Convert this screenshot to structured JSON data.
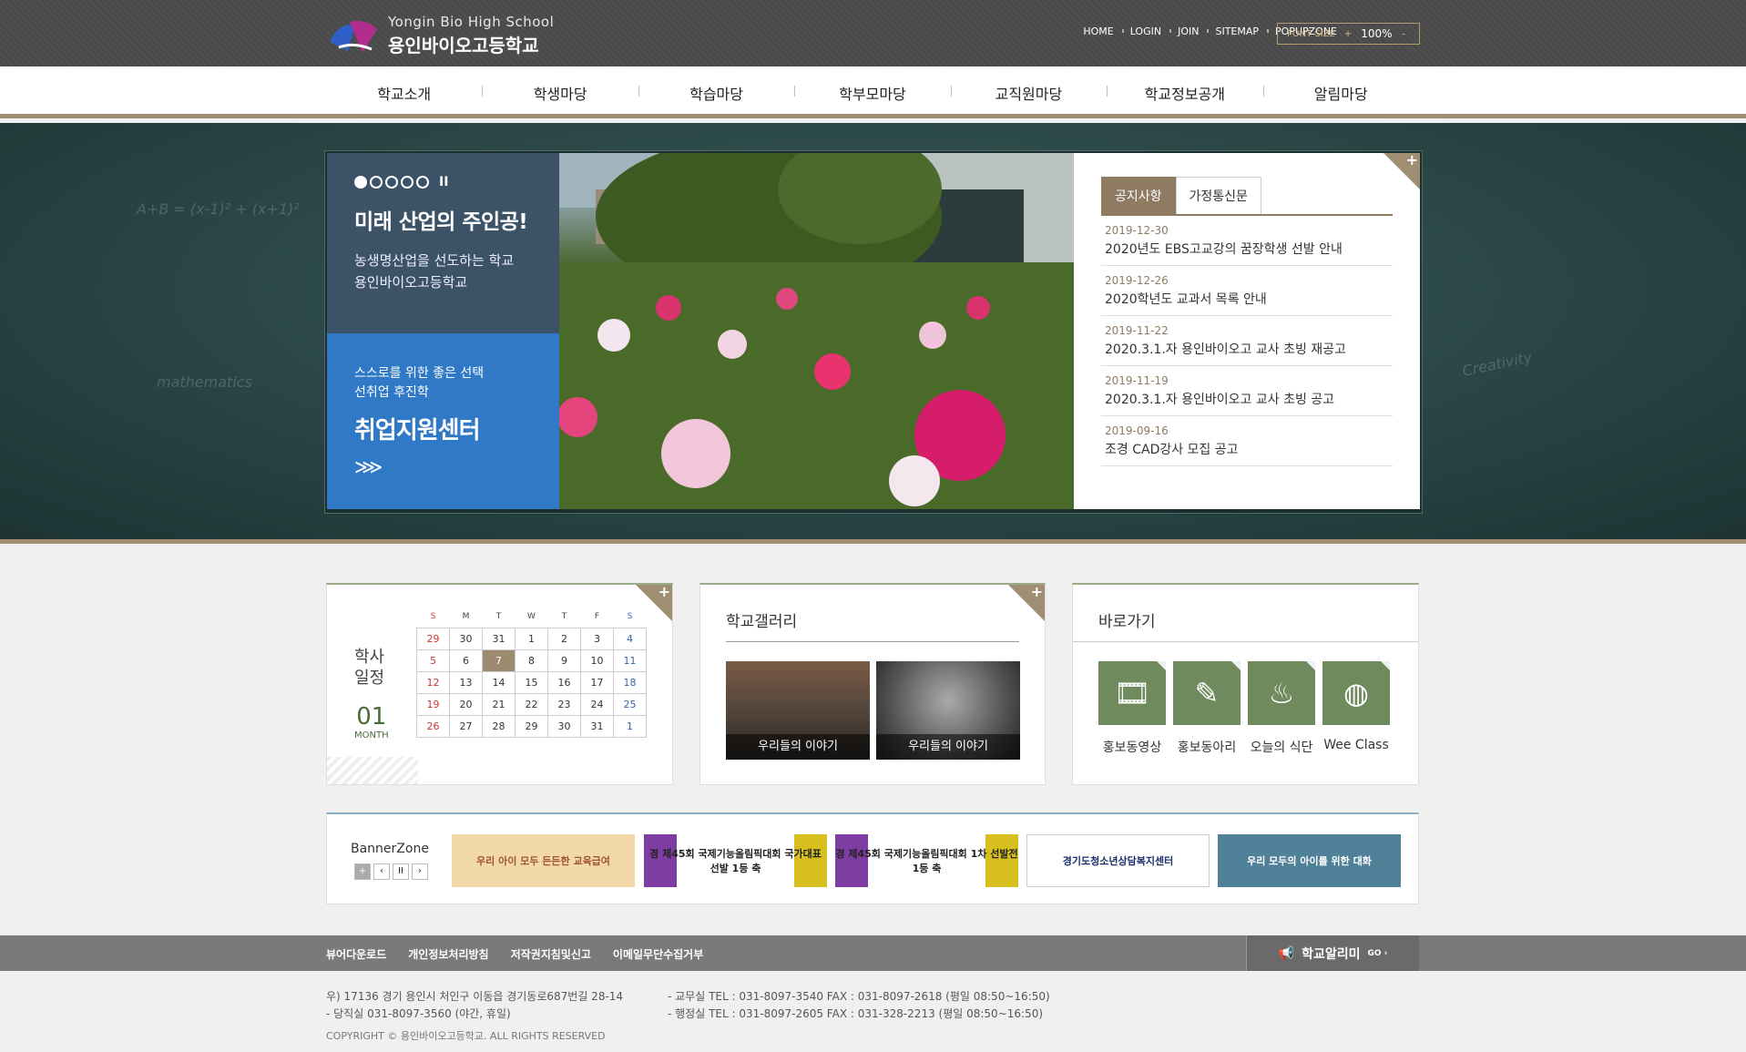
{
  "header": {
    "logo_en": "Yongin Bio High School",
    "logo_ko": "용인바이오고등학교",
    "util_links": [
      "HOME",
      "LOGIN",
      "JOIN",
      "SITEMAP",
      "POPUPZONE"
    ],
    "font_size_label": "FONT SIZE",
    "font_plus": "+",
    "font_pct": "100%",
    "font_minus": "–"
  },
  "nav": [
    "학교소개",
    "학생마당",
    "학습마당",
    "학부모마당",
    "교직원마당",
    "학교정보공개",
    "알림마당"
  ],
  "hero": {
    "slogan": "미래 산업의 주인공!",
    "slogan_sub1": "농생명산업을 선도하는 학교",
    "slogan_sub2": "용인바이오고등학교",
    "career_s1": "스스로를 위한 좋은 선택",
    "career_s2": "선취업 후진학",
    "career_big": "취업지원센터",
    "chalk": [
      "A+B = (x-1)² + (x+1)²",
      "mathematics",
      "Creativity"
    ]
  },
  "notice": {
    "tabs": [
      "공지사항",
      "가정통신문"
    ],
    "items": [
      {
        "date": "2019-12-30",
        "title": "2020년도 EBS고교강의 꿈장학생 선발 안내"
      },
      {
        "date": "2019-12-26",
        "title": "2020학년도 교과서 목록 안내"
      },
      {
        "date": "2019-11-22",
        "title": "2020.3.1.자 용인바이오고 교사 초빙 재공고"
      },
      {
        "date": "2019-11-19",
        "title": "2020.3.1.자 용인바이오고 교사 초빙 공고"
      },
      {
        "date": "2019-09-16",
        "title": "조경 CAD강사 모집 공고"
      }
    ]
  },
  "calendar": {
    "title1": "학사",
    "title2": "일정",
    "month": "01",
    "month_label": "MONTH",
    "weekdays": [
      "S",
      "M",
      "T",
      "W",
      "T",
      "F",
      "S"
    ],
    "weeks": [
      [
        "29",
        "30",
        "31",
        "1",
        "2",
        "3",
        "4"
      ],
      [
        "5",
        "6",
        "7",
        "8",
        "9",
        "10",
        "11"
      ],
      [
        "12",
        "13",
        "14",
        "15",
        "16",
        "17",
        "18"
      ],
      [
        "19",
        "20",
        "21",
        "22",
        "23",
        "24",
        "25"
      ],
      [
        "26",
        "27",
        "28",
        "29",
        "30",
        "31",
        "1"
      ]
    ],
    "today": "7"
  },
  "gallery": {
    "title": "학교갤러리",
    "items": [
      "우리들의 이야기",
      "우리들의 이야기"
    ]
  },
  "shortcuts": {
    "title": "바로가기",
    "items": [
      {
        "label": "홍보동영상",
        "icon": "projector-icon"
      },
      {
        "label": "홍보동아리",
        "icon": "pencil-icon"
      },
      {
        "label": "오늘의 식단",
        "icon": "pot-icon"
      },
      {
        "label": "Wee Class",
        "icon": "globe-icon"
      }
    ]
  },
  "bannerzone": {
    "title": "BannerZone",
    "controls": [
      "+",
      "‹",
      "II",
      "›"
    ],
    "banners": [
      "우리 아이 모두 든든한 교육급여",
      "경 제45회 국제기능올림픽대회 국가대표 선발 1등 축",
      "경 제45회 국제기능올림픽대회 1차 선발전 1등 축",
      "경기도청소년상담복지센터",
      "우리 모두의 아이를 위한 대화"
    ]
  },
  "footer": {
    "links": [
      "뷰어다운로드",
      "개인정보처리방침",
      "저작권지침및신고",
      "이메일무단수집거부"
    ],
    "alert": "학교알리미",
    "alert_go": "GO ›",
    "address": "우) 17136 경기 용인시 처인구 이동읍 경기동로687번길 28-14",
    "night": "- 당직실 031-8097-3560 (야간, 휴일)",
    "office1": "- 교무실 TEL : 031-8097-3540 FAX : 031-8097-2618 (평일 08:50~16:50)",
    "office2": "- 행정실 TEL : 031-8097-2605 FAX : 031-328-2213 (평일 08:50~16:50)",
    "copyright": "COPYRIGHT © 용인바이오고등학교. ALL RIGHTS RESERVED"
  }
}
